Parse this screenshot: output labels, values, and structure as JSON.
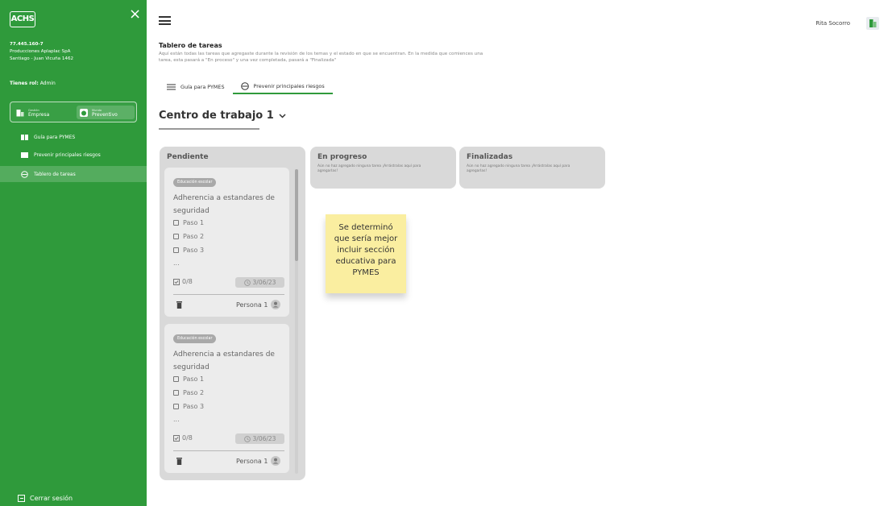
{
  "sidebar": {
    "logo_text": "ACHS",
    "close_icon": "×",
    "rut": "77.445.160-7",
    "company": "Producciones Aplaplac SpA",
    "address": "Santiago - Juan Vicuña 1462",
    "role_label": "Tienes rol:",
    "role_value": "Admin",
    "modules": [
      {
        "small": "Gestión",
        "big": "Empresa",
        "icon": "building-icon"
      },
      {
        "small": "Mundo",
        "big": "Preventivo",
        "icon": "preventive-world-icon"
      }
    ],
    "items": [
      {
        "label": "Guía para PYMES",
        "icon": "guide-icon"
      },
      {
        "label": "Prevenir principales riesgos",
        "icon": "risk-icon"
      },
      {
        "label": "Tablero de tareas",
        "icon": "board-icon"
      }
    ],
    "logout": "Cerrar sesión"
  },
  "header": {
    "user_name": "Rita Socorro"
  },
  "page": {
    "title": "Tablero de tareas",
    "description": "Aquí están todas las tareas que agregaste durante la revisión de los temas y el estado en que se encuentran. En la medida que comiences una tarea, esta pasará a \"En proceso\" y una vez completada, pasará a \"Finalizada\"",
    "tabs": [
      {
        "label": "Guía para PYMES",
        "icon": "list-icon"
      },
      {
        "label": "Prevenir principales riesgos",
        "icon": "risk-icon"
      }
    ],
    "work_center": "Centro de trabajo 1"
  },
  "board": {
    "columns": [
      {
        "title": "Pendiente",
        "sub": ""
      },
      {
        "title": "En progreso",
        "sub": "Aún no haz agregado ninguna tarea ¡Arrástralas aquí para agregarlas!"
      },
      {
        "title": "Finalizadas",
        "sub": "Aún no haz agregado ninguna tarea ¡Arrástralas aquí para agregarlas!"
      }
    ],
    "cards": [
      {
        "chip": "Educación escolar",
        "title": "Adherencia a estandares de seguridad",
        "steps": [
          "Paso 1",
          "Paso 2",
          "Paso 3"
        ],
        "ellipsis": "...",
        "progress": "0/8",
        "date": "3/06/23",
        "person": "Persona 1"
      },
      {
        "chip": "Educación escolar",
        "title": "Adherencia a estandares de seguridad",
        "steps": [
          "Paso 1",
          "Paso 2",
          "Paso 3"
        ],
        "ellipsis": "...",
        "progress": "0/8",
        "date": "3/06/23",
        "person": "Persona 1"
      }
    ]
  },
  "sticky_note": "Se determinó que sería mejor incluir sección educativa para PYMES",
  "colors": {
    "brand_green": "#2f9a3b",
    "sticky_yellow": "#faeea0",
    "column_gray": "#d9d9d9"
  }
}
